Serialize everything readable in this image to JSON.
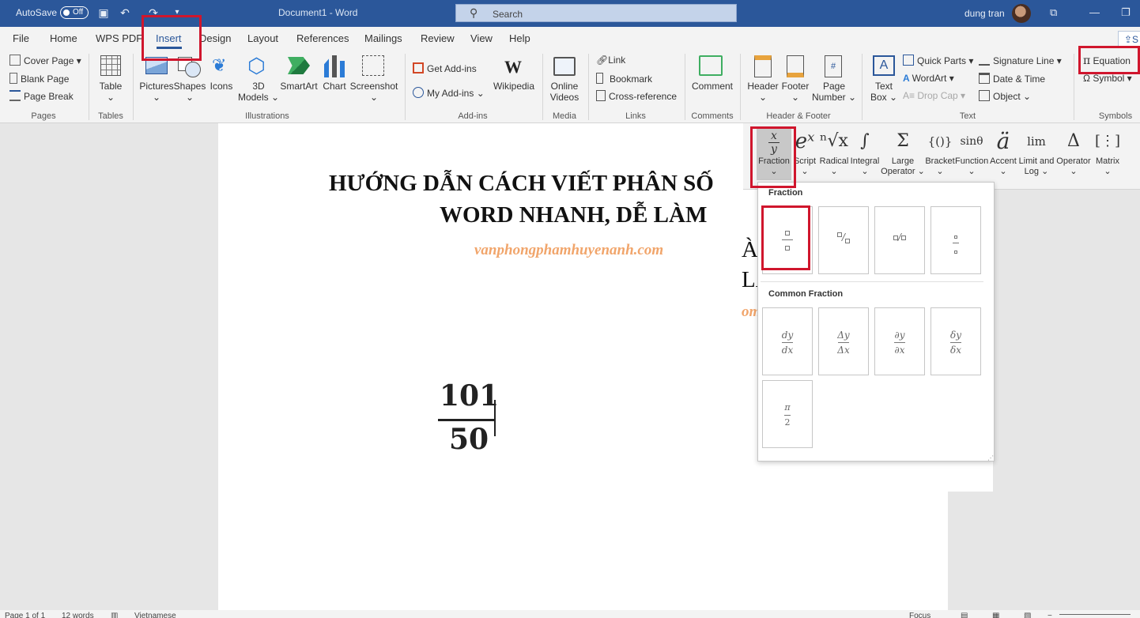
{
  "titlebar": {
    "autosave_label": "AutoSave",
    "autosave_state": "Off",
    "document_title": "Document1 - Word",
    "search_placeholder": "Search",
    "user_name": "dung tran"
  },
  "tabs": [
    "File",
    "Home",
    "WPS PDF",
    "Insert",
    "Design",
    "Layout",
    "References",
    "Mailings",
    "Review",
    "View",
    "Help"
  ],
  "active_tab": "Insert",
  "ribbon": {
    "pages": {
      "cover_page": "Cover Page",
      "blank_page": "Blank Page",
      "page_break": "Page Break",
      "group": "Pages"
    },
    "tables": {
      "table": "Table",
      "group": "Tables"
    },
    "illustrations": {
      "pictures": "Pictures",
      "shapes": "Shapes",
      "icons": "Icons",
      "models_3d": "3D",
      "models_3d_2": "Models",
      "smartart": "SmartArt",
      "chart": "Chart",
      "screenshot": "Screenshot",
      "group": "Illustrations"
    },
    "addins": {
      "get_addins": "Get Add-ins",
      "my_addins": "My Add-ins",
      "wikipedia": "Wikipedia",
      "group": "Add-ins"
    },
    "media": {
      "online_videos_1": "Online",
      "online_videos_2": "Videos",
      "group": "Media"
    },
    "links": {
      "link": "Link",
      "bookmark": "Bookmark",
      "cross_reference": "Cross-reference",
      "group": "Links"
    },
    "comments": {
      "comment": "Comment",
      "group": "Comments"
    },
    "header_footer": {
      "header": "Header",
      "footer": "Footer",
      "page_number_1": "Page",
      "page_number_2": "Number",
      "group": "Header & Footer"
    },
    "text": {
      "text_box_1": "Text",
      "text_box_2": "Box",
      "quick_parts": "Quick Parts",
      "wordart": "WordArt",
      "drop_cap": "Drop Cap",
      "signature_line": "Signature Line",
      "date_time": "Date & Time",
      "object": "Object",
      "group": "Text"
    },
    "symbols": {
      "equation": "Equation",
      "symbol": "Symbol",
      "group": "Symbols"
    }
  },
  "document": {
    "heading_line1": "HƯỚNG DẪN CÁCH VIẾT PHÂN SỐ",
    "heading_line2": "WORD NHANH, DỄ LÀM",
    "website": "vanphongphamhuyenanh.com",
    "fraction_numerator": "101",
    "fraction_denominator": "50",
    "ghost_1": "ÀN",
    "ghost_2": "LA",
    "ghost_3": "om"
  },
  "equation_tools": [
    {
      "id": "fraction",
      "symbol": "x/y",
      "label": "Fraction"
    },
    {
      "id": "script",
      "symbol": "eˣ",
      "label": "Script"
    },
    {
      "id": "radical",
      "symbol": "ⁿ√x",
      "label": "Radical"
    },
    {
      "id": "integral",
      "symbol": "∫",
      "label": "Integral"
    },
    {
      "id": "large-operator",
      "symbol": "Σ",
      "label": "Large",
      "label2": "Operator"
    },
    {
      "id": "bracket",
      "symbol": "{()}",
      "label": "Bracket"
    },
    {
      "id": "function",
      "symbol": "sinθ",
      "label": "Function"
    },
    {
      "id": "accent",
      "symbol": "ä",
      "label": "Accent"
    },
    {
      "id": "limit-log",
      "symbol": "lim",
      "label": "Limit and",
      "label2": "Log"
    },
    {
      "id": "operator",
      "symbol": "Δ",
      "label": "Operator"
    },
    {
      "id": "matrix",
      "symbol": "[⋮]",
      "label": "Matrix"
    }
  ],
  "fraction_menu": {
    "section1": "Fraction",
    "section2": "Common Fraction",
    "common": [
      {
        "num": "dy",
        "den": "dx"
      },
      {
        "num": "Δy",
        "den": "Δx"
      },
      {
        "num": "∂y",
        "den": "∂x"
      },
      {
        "num": "δy",
        "den": "δx"
      },
      {
        "num": "π",
        "den": "2"
      }
    ]
  },
  "statusbar": {
    "page": "Page 1 of 1",
    "words": "12 words",
    "language": "Vietnamese",
    "focus": "Focus"
  },
  "colors": {
    "accent": "#2b579a",
    "highlight": "#d0162d",
    "website_orange": "#f1a56b"
  }
}
